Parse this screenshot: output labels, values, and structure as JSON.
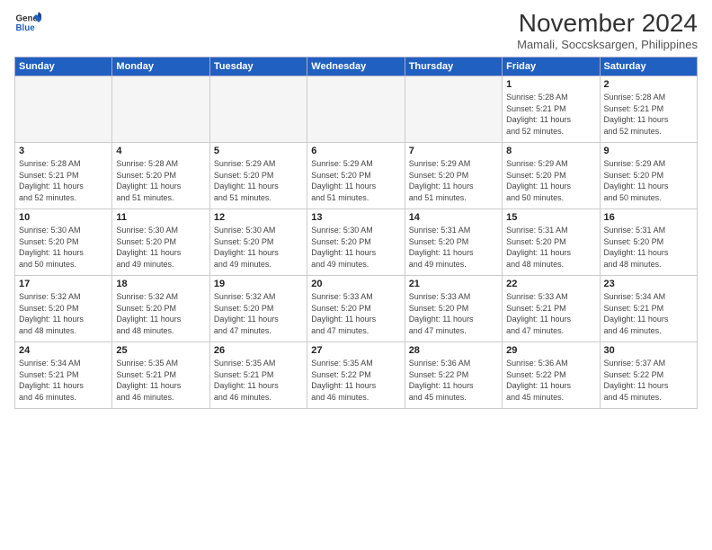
{
  "header": {
    "logo_line1": "General",
    "logo_line2": "Blue",
    "month_title": "November 2024",
    "location": "Mamali, Soccsksargen, Philippines"
  },
  "weekdays": [
    "Sunday",
    "Monday",
    "Tuesday",
    "Wednesday",
    "Thursday",
    "Friday",
    "Saturday"
  ],
  "weeks": [
    [
      {
        "day": "",
        "info": "",
        "empty": true
      },
      {
        "day": "",
        "info": "",
        "empty": true
      },
      {
        "day": "",
        "info": "",
        "empty": true
      },
      {
        "day": "",
        "info": "",
        "empty": true
      },
      {
        "day": "",
        "info": "",
        "empty": true
      },
      {
        "day": "1",
        "info": "Sunrise: 5:28 AM\nSunset: 5:21 PM\nDaylight: 11 hours\nand 52 minutes."
      },
      {
        "day": "2",
        "info": "Sunrise: 5:28 AM\nSunset: 5:21 PM\nDaylight: 11 hours\nand 52 minutes."
      }
    ],
    [
      {
        "day": "3",
        "info": "Sunrise: 5:28 AM\nSunset: 5:21 PM\nDaylight: 11 hours\nand 52 minutes."
      },
      {
        "day": "4",
        "info": "Sunrise: 5:28 AM\nSunset: 5:20 PM\nDaylight: 11 hours\nand 51 minutes."
      },
      {
        "day": "5",
        "info": "Sunrise: 5:29 AM\nSunset: 5:20 PM\nDaylight: 11 hours\nand 51 minutes."
      },
      {
        "day": "6",
        "info": "Sunrise: 5:29 AM\nSunset: 5:20 PM\nDaylight: 11 hours\nand 51 minutes."
      },
      {
        "day": "7",
        "info": "Sunrise: 5:29 AM\nSunset: 5:20 PM\nDaylight: 11 hours\nand 51 minutes."
      },
      {
        "day": "8",
        "info": "Sunrise: 5:29 AM\nSunset: 5:20 PM\nDaylight: 11 hours\nand 50 minutes."
      },
      {
        "day": "9",
        "info": "Sunrise: 5:29 AM\nSunset: 5:20 PM\nDaylight: 11 hours\nand 50 minutes."
      }
    ],
    [
      {
        "day": "10",
        "info": "Sunrise: 5:30 AM\nSunset: 5:20 PM\nDaylight: 11 hours\nand 50 minutes."
      },
      {
        "day": "11",
        "info": "Sunrise: 5:30 AM\nSunset: 5:20 PM\nDaylight: 11 hours\nand 49 minutes."
      },
      {
        "day": "12",
        "info": "Sunrise: 5:30 AM\nSunset: 5:20 PM\nDaylight: 11 hours\nand 49 minutes."
      },
      {
        "day": "13",
        "info": "Sunrise: 5:30 AM\nSunset: 5:20 PM\nDaylight: 11 hours\nand 49 minutes."
      },
      {
        "day": "14",
        "info": "Sunrise: 5:31 AM\nSunset: 5:20 PM\nDaylight: 11 hours\nand 49 minutes."
      },
      {
        "day": "15",
        "info": "Sunrise: 5:31 AM\nSunset: 5:20 PM\nDaylight: 11 hours\nand 48 minutes."
      },
      {
        "day": "16",
        "info": "Sunrise: 5:31 AM\nSunset: 5:20 PM\nDaylight: 11 hours\nand 48 minutes."
      }
    ],
    [
      {
        "day": "17",
        "info": "Sunrise: 5:32 AM\nSunset: 5:20 PM\nDaylight: 11 hours\nand 48 minutes."
      },
      {
        "day": "18",
        "info": "Sunrise: 5:32 AM\nSunset: 5:20 PM\nDaylight: 11 hours\nand 48 minutes."
      },
      {
        "day": "19",
        "info": "Sunrise: 5:32 AM\nSunset: 5:20 PM\nDaylight: 11 hours\nand 47 minutes."
      },
      {
        "day": "20",
        "info": "Sunrise: 5:33 AM\nSunset: 5:20 PM\nDaylight: 11 hours\nand 47 minutes."
      },
      {
        "day": "21",
        "info": "Sunrise: 5:33 AM\nSunset: 5:20 PM\nDaylight: 11 hours\nand 47 minutes."
      },
      {
        "day": "22",
        "info": "Sunrise: 5:33 AM\nSunset: 5:21 PM\nDaylight: 11 hours\nand 47 minutes."
      },
      {
        "day": "23",
        "info": "Sunrise: 5:34 AM\nSunset: 5:21 PM\nDaylight: 11 hours\nand 46 minutes."
      }
    ],
    [
      {
        "day": "24",
        "info": "Sunrise: 5:34 AM\nSunset: 5:21 PM\nDaylight: 11 hours\nand 46 minutes."
      },
      {
        "day": "25",
        "info": "Sunrise: 5:35 AM\nSunset: 5:21 PM\nDaylight: 11 hours\nand 46 minutes."
      },
      {
        "day": "26",
        "info": "Sunrise: 5:35 AM\nSunset: 5:21 PM\nDaylight: 11 hours\nand 46 minutes."
      },
      {
        "day": "27",
        "info": "Sunrise: 5:35 AM\nSunset: 5:22 PM\nDaylight: 11 hours\nand 46 minutes."
      },
      {
        "day": "28",
        "info": "Sunrise: 5:36 AM\nSunset: 5:22 PM\nDaylight: 11 hours\nand 45 minutes."
      },
      {
        "day": "29",
        "info": "Sunrise: 5:36 AM\nSunset: 5:22 PM\nDaylight: 11 hours\nand 45 minutes."
      },
      {
        "day": "30",
        "info": "Sunrise: 5:37 AM\nSunset: 5:22 PM\nDaylight: 11 hours\nand 45 minutes."
      }
    ]
  ]
}
